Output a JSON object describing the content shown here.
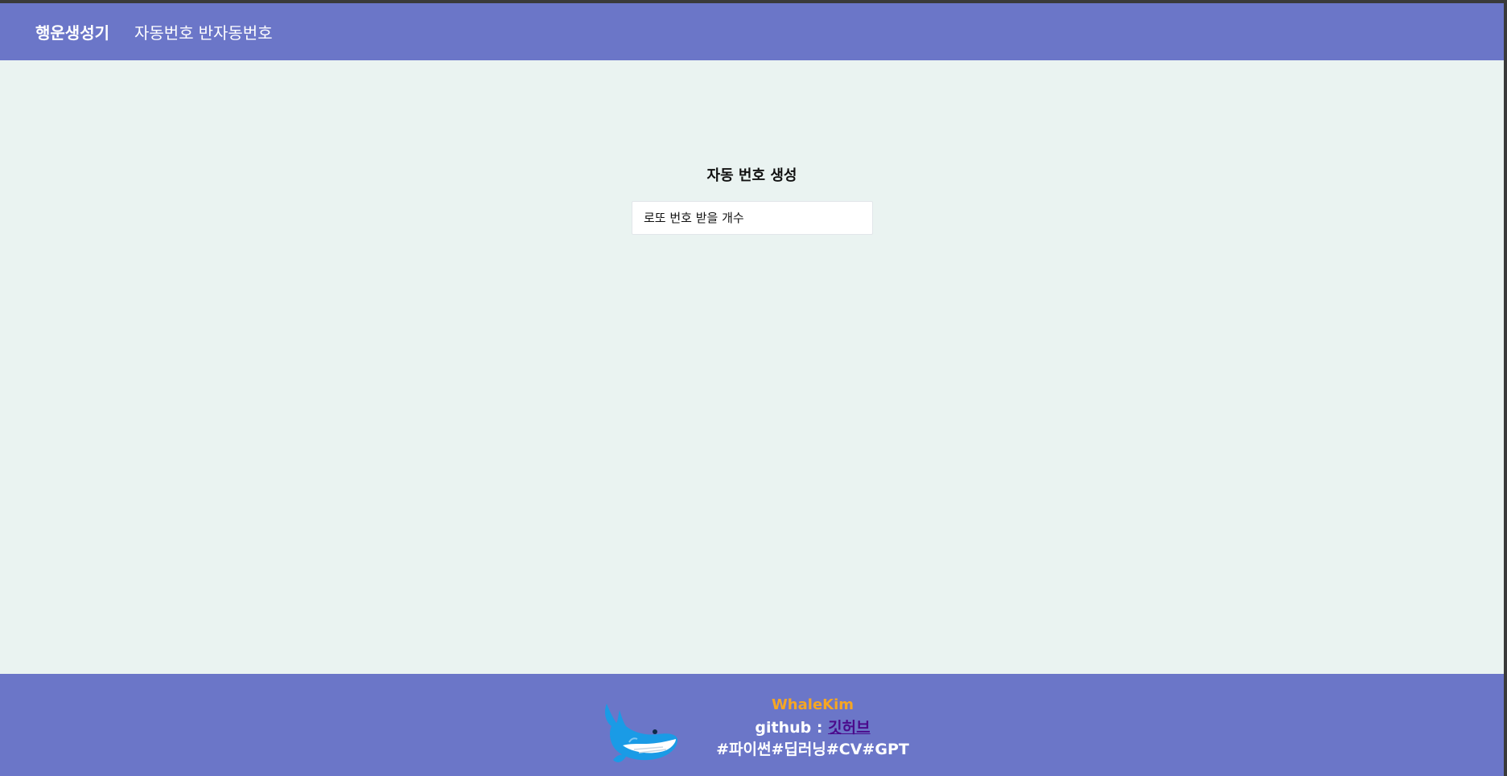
{
  "navbar": {
    "brand": "행운생성기",
    "links": [
      "자동번호",
      "반자동번호"
    ]
  },
  "main": {
    "title": "자동 번호 생성",
    "input": {
      "placeholder": "로또 번호 받을 개수",
      "value": ""
    }
  },
  "footer": {
    "author": "WhaleKim",
    "github_label": "github :",
    "github_link_text": "깃허브",
    "tags": "#파이썬#딥러닝#CV#GPT",
    "logo_icon": "whale-icon"
  },
  "colors": {
    "navbar_bg": "#6b76c8",
    "page_bg": "#eaf3f1",
    "author": "#f5a623",
    "link": "#4b0a8c"
  }
}
